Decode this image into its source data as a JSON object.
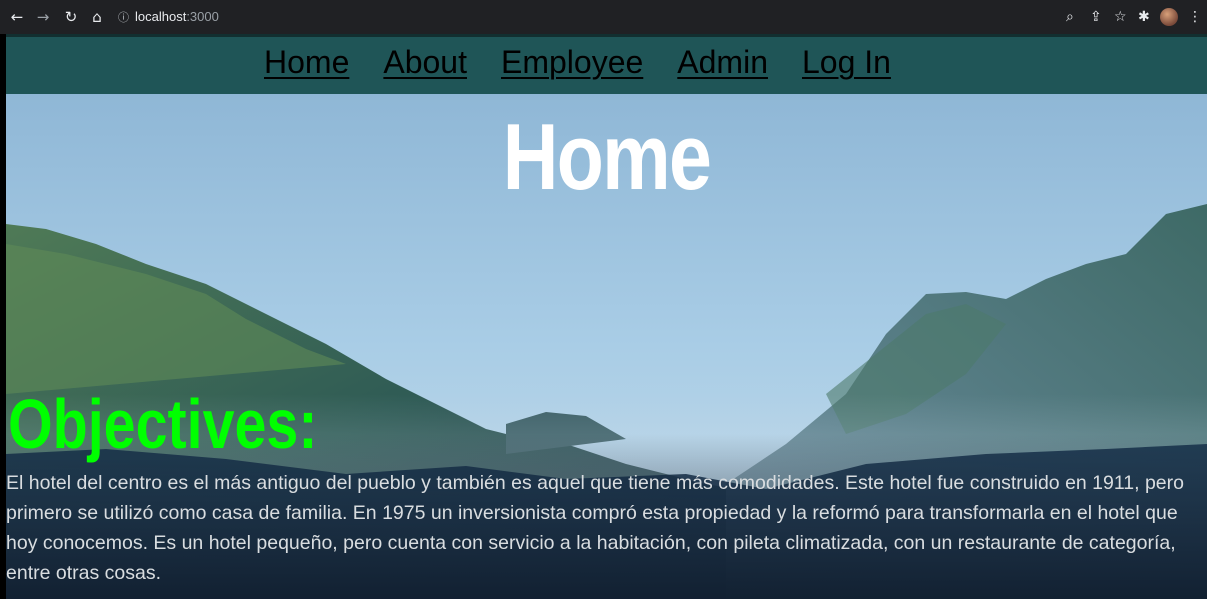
{
  "browser": {
    "url_host": "localhost",
    "url_port": ":3000"
  },
  "nav": {
    "items": [
      {
        "label": "Home"
      },
      {
        "label": "About"
      },
      {
        "label": "Employee"
      },
      {
        "label": "Admin"
      },
      {
        "label": "Log In"
      }
    ]
  },
  "hero": {
    "title": "Home"
  },
  "objectives": {
    "heading": "Objectives:",
    "text": "El hotel del centro es el más antiguo del pueblo y también es aquel que tiene más comodidades. Este hotel fue construido en 1911, pero primero se utilizó como casa de familia. En 1975 un inversionista compró esta propiedad y la reformó para transformarla en el hotel que hoy conocemos. Es un hotel pequeño, pero cuenta con servicio a la habitación, con pileta climatizada, con un restaurante de categoría, entre otras cosas."
  },
  "colors": {
    "nav_bg": "#1f5557",
    "objectives_heading": "#00ff00",
    "hero_title": "#ffffff"
  }
}
